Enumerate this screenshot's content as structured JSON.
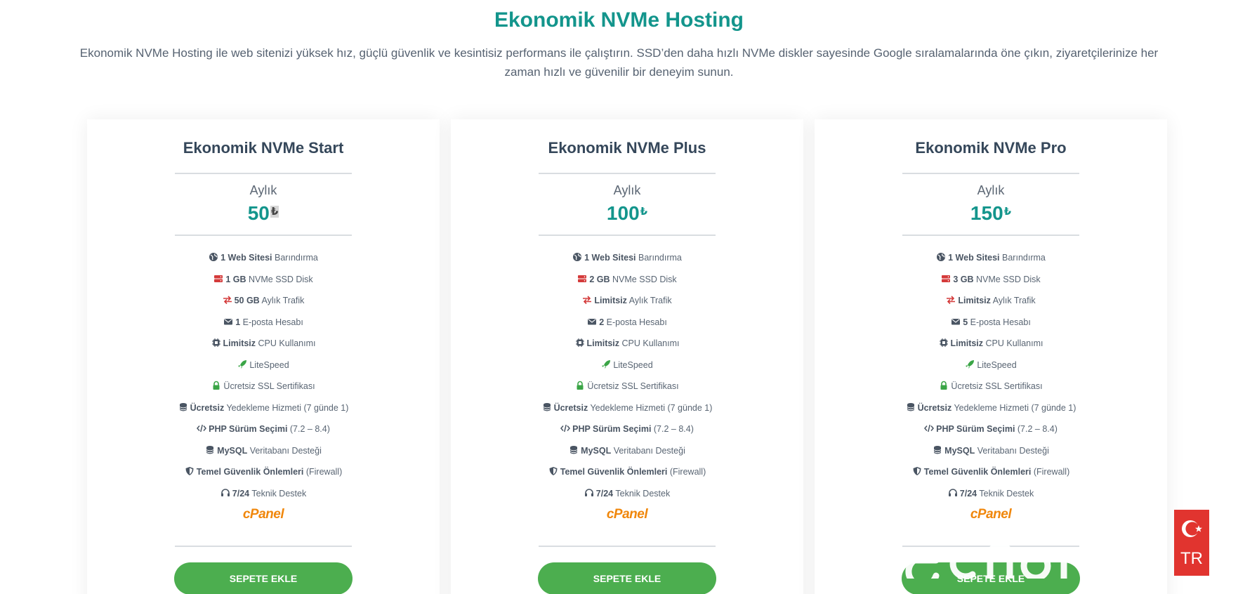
{
  "header": {
    "title": "Ekonomik NVMe Hosting",
    "description": "Ekonomik NVMe Hosting ile web sitenizi yüksek hız, güçlü güvenlik ve kesintisiz performans ile çalıştırın. SSD’den daha hızlı NVMe diskler sayesinde Google sıralamalarında öne çıkın, ziyaretçilerinize her zaman hızlı ve güvenilir bir deneyim sunun."
  },
  "colors": {
    "accent": "#13958c",
    "button": "#4cae4f",
    "disk_icon": "#d43a3a",
    "traffic_icon": "#d43a3a",
    "litespeed_icon": "#3aa546",
    "ssl_icon": "#3aa546",
    "cpanel": "#f0870c",
    "lang_badge": "#e1342f"
  },
  "plans": [
    {
      "name": "Ekonomik NVMe Start",
      "period": "Aylık",
      "price": "50",
      "currency": "₺",
      "features": [
        {
          "icon": "globe-icon",
          "bold": "1 Web Sitesi",
          "text": " Barındırma"
        },
        {
          "icon": "server-icon",
          "bold": "1 GB",
          "text": " NVMe SSD Disk"
        },
        {
          "icon": "exchange-icon",
          "bold": "50 GB",
          "text": " Aylık Trafik"
        },
        {
          "icon": "envelope-icon",
          "bold": "1",
          "text": " E-posta Hesabı"
        },
        {
          "icon": "cpu-icon",
          "bold": "Limitsiz",
          "text": " CPU Kullanımı"
        },
        {
          "icon": "rocket-icon",
          "bold": "",
          "text": "LiteSpeed"
        },
        {
          "icon": "lock-icon",
          "bold": "",
          "text": "Ücretsiz SSL Sertifikası"
        },
        {
          "icon": "database-icon",
          "bold": "Ücretsiz",
          "text": " Yedekleme Hizmeti (7 günde 1)"
        },
        {
          "icon": "code-icon",
          "bold": "PHP Sürüm Seçimi",
          "text": " (7.2 – 8.4)"
        },
        {
          "icon": "database-icon",
          "bold": "MySQL",
          "text": " Veritabanı Desteği"
        },
        {
          "icon": "shield-icon",
          "bold": "Temel Güvenlik Önlemleri",
          "text": " (Firewall)"
        },
        {
          "icon": "headset-icon",
          "bold": "7/24",
          "text": " Teknik Destek"
        }
      ],
      "panel": "cPanel",
      "button": "SEPETE EKLE"
    },
    {
      "name": "Ekonomik NVMe Plus",
      "period": "Aylık",
      "price": "100",
      "currency": "₺",
      "features": [
        {
          "icon": "globe-icon",
          "bold": "1 Web Sitesi",
          "text": " Barındırma"
        },
        {
          "icon": "server-icon",
          "bold": "2 GB",
          "text": " NVMe SSD Disk"
        },
        {
          "icon": "exchange-icon",
          "bold": "Limitsiz",
          "text": " Aylık Trafik"
        },
        {
          "icon": "envelope-icon",
          "bold": "2",
          "text": " E-posta Hesabı"
        },
        {
          "icon": "cpu-icon",
          "bold": "Limitsiz",
          "text": " CPU Kullanımı"
        },
        {
          "icon": "rocket-icon",
          "bold": "",
          "text": "LiteSpeed"
        },
        {
          "icon": "lock-icon",
          "bold": "",
          "text": "Ücretsiz SSL Sertifikası"
        },
        {
          "icon": "database-icon",
          "bold": "Ücretsiz",
          "text": " Yedekleme Hizmeti (7 günde 1)"
        },
        {
          "icon": "code-icon",
          "bold": "PHP Sürüm Seçimi",
          "text": " (7.2 – 8.4)"
        },
        {
          "icon": "database-icon",
          "bold": "MySQL",
          "text": " Veritabanı Desteği"
        },
        {
          "icon": "shield-icon",
          "bold": "Temel Güvenlik Önlemleri",
          "text": " (Firewall)"
        },
        {
          "icon": "headset-icon",
          "bold": "7/24",
          "text": " Teknik Destek"
        }
      ],
      "panel": "cPanel",
      "button": "SEPETE EKLE"
    },
    {
      "name": "Ekonomik NVMe Pro",
      "period": "Aylık",
      "price": "150",
      "currency": "₺",
      "features": [
        {
          "icon": "globe-icon",
          "bold": "1 Web Sitesi",
          "text": " Barındırma"
        },
        {
          "icon": "server-icon",
          "bold": "3 GB",
          "text": " NVMe SSD Disk"
        },
        {
          "icon": "exchange-icon",
          "bold": "Limitsiz",
          "text": " Aylık Trafik"
        },
        {
          "icon": "envelope-icon",
          "bold": "5",
          "text": " E-posta Hesabı"
        },
        {
          "icon": "cpu-icon",
          "bold": "Limitsiz",
          "text": " CPU Kullanımı"
        },
        {
          "icon": "rocket-icon",
          "bold": "",
          "text": "LiteSpeed"
        },
        {
          "icon": "lock-icon",
          "bold": "",
          "text": "Ücretsiz SSL Sertifikası"
        },
        {
          "icon": "database-icon",
          "bold": "Ücretsiz",
          "text": " Yedekleme Hizmeti (7 günde 1)"
        },
        {
          "icon": "code-icon",
          "bold": "PHP Sürüm Seçimi",
          "text": " (7.2 – 8.4)"
        },
        {
          "icon": "database-icon",
          "bold": "MySQL",
          "text": " Veritabanı Desteği"
        },
        {
          "icon": "shield-icon",
          "bold": "Temel Güvenlik Önlemleri",
          "text": " (Firewall)"
        },
        {
          "icon": "headset-icon",
          "bold": "7/24",
          "text": " Teknik Destek"
        }
      ],
      "panel": "cPanel",
      "button": "SEPETE EKLE"
    }
  ],
  "language_badge": {
    "code": "TR",
    "icon": "turkey-flag-icon"
  }
}
